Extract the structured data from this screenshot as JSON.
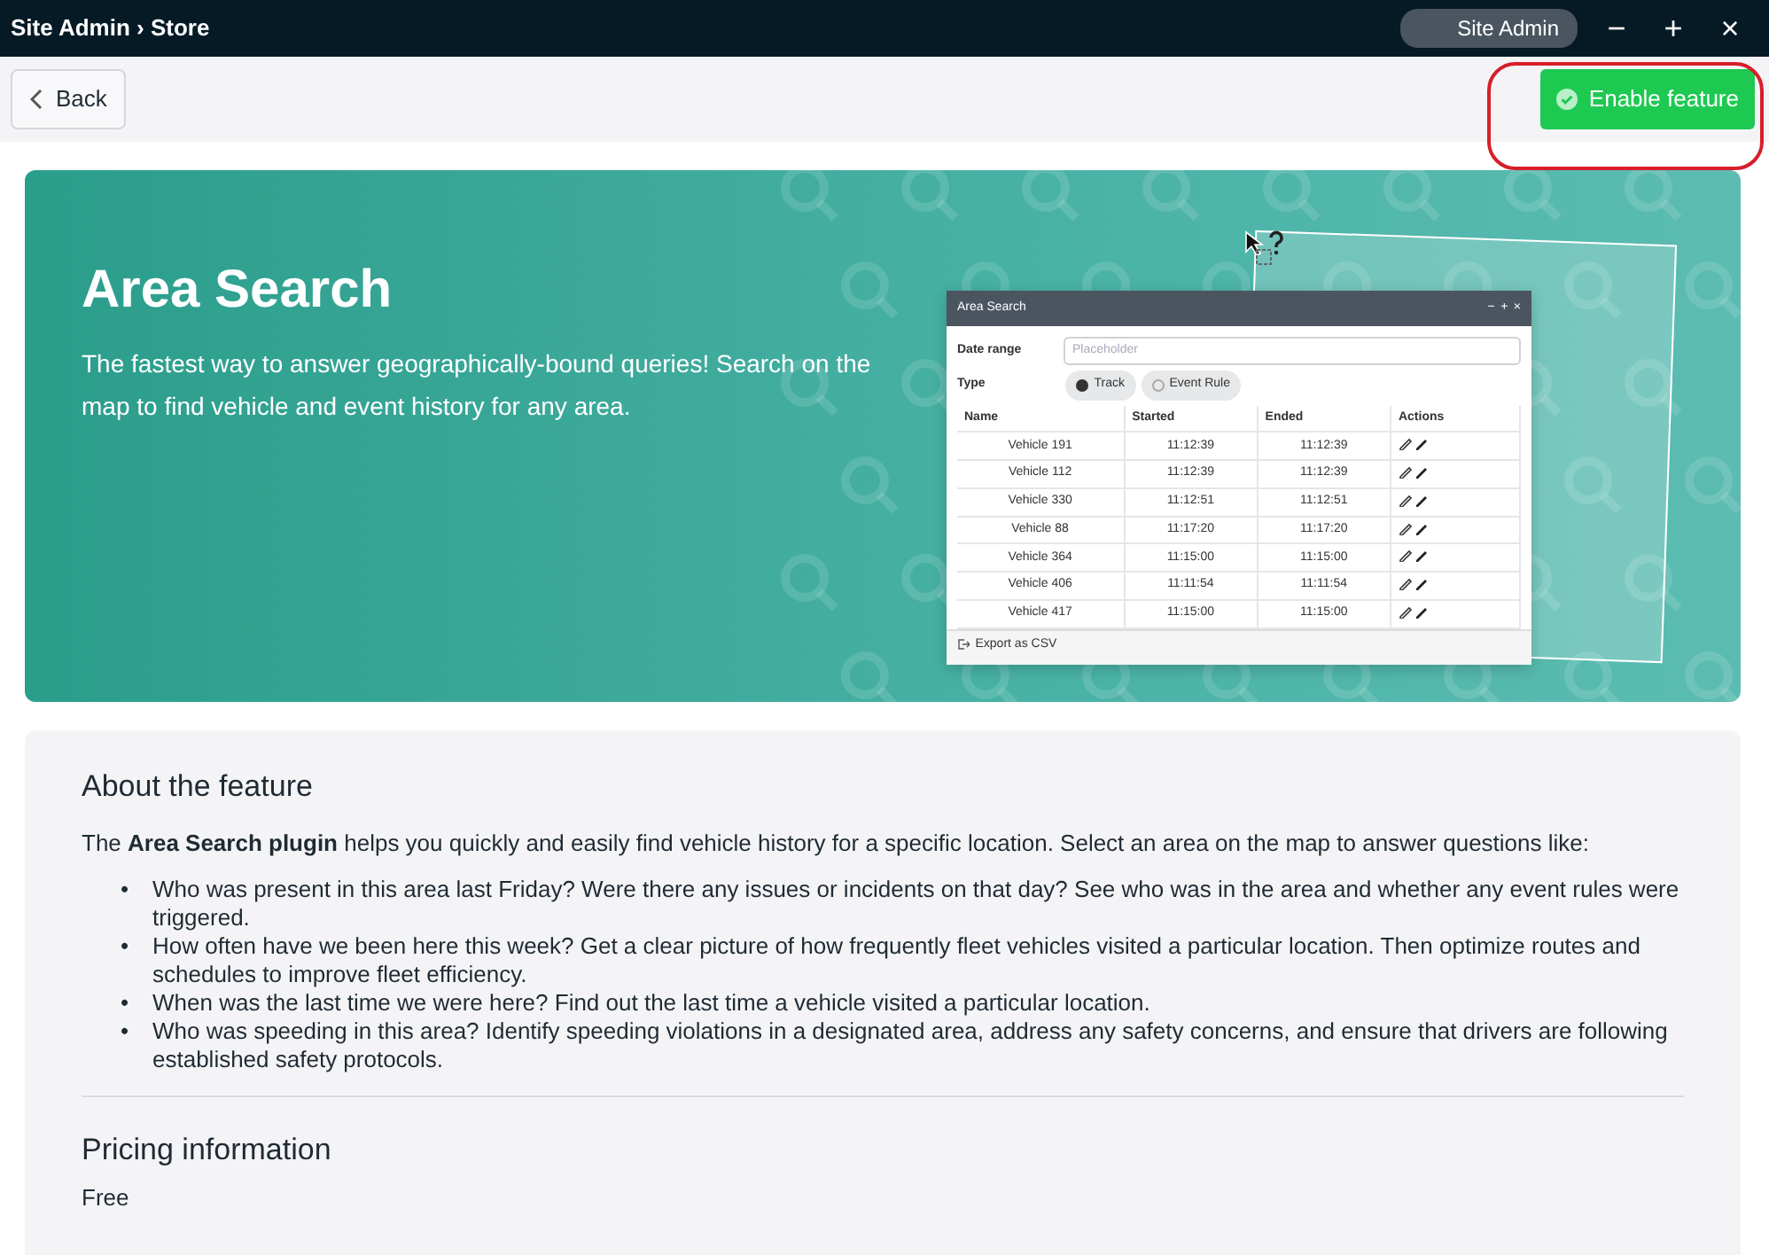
{
  "window": {
    "title": "Site Admin › Store",
    "user": "Site Admin",
    "controls": [
      "−",
      "+",
      "×"
    ]
  },
  "toolbar": {
    "back": "Back",
    "enable": "Enable feature"
  },
  "hero": {
    "title": "Area Search",
    "description": "The fastest way to answer geographically-bound queries! Search on the map to find vehicle and event history for any area.",
    "mockup": {
      "title": "Area Search",
      "controls": [
        "−",
        "+",
        "×"
      ],
      "date_label": "Date range",
      "date_placeholder": "Placeholder",
      "type_label": "Type",
      "options": [
        {
          "label": "Track",
          "selected": true
        },
        {
          "label": "Event Rule",
          "selected": false
        }
      ],
      "columns": [
        "Name",
        "Started",
        "Ended",
        "Actions"
      ],
      "rows": [
        {
          "name": "Vehicle 191",
          "started": "11:12:39",
          "ended": "11:12:39"
        },
        {
          "name": "Vehicle 112",
          "started": "11:12:39",
          "ended": "11:12:39"
        },
        {
          "name": "Vehicle 330",
          "started": "11:12:51",
          "ended": "11:12:51"
        },
        {
          "name": "Vehicle 88",
          "started": "11:17:20",
          "ended": "11:17:20"
        },
        {
          "name": "Vehicle 364",
          "started": "11:15:00",
          "ended": "11:15:00"
        },
        {
          "name": "Vehicle 406",
          "started": "11:11:54",
          "ended": "11:11:54"
        },
        {
          "name": "Vehicle 417",
          "started": "11:15:00",
          "ended": "11:15:00"
        }
      ],
      "export": "Export as CSV"
    }
  },
  "about": {
    "heading": "About the feature",
    "intro": "The **Area Search plugin** helps you quickly and easily find vehicle history for a specific location. Select an area on the map to answer questions like:",
    "marker": "•",
    "bullets": [
      "Who was present in this area last Friday? Were there any issues or incidents on that day? See who was in the area and whether any event rules were triggered.",
      "How often have we been here this week? Get a clear picture of how frequently fleet vehicles visited a particular location. Then optimize routes and schedules to improve fleet efficiency.",
      "When was the last time we were here? Find out the last time a vehicle visited a particular location.",
      "Who was speeding in this area? Identify speeding violations in a designated area, address any safety concerns, and ensure that drivers are following established safety protocols."
    ]
  },
  "pricing": {
    "heading": "Pricing information",
    "value": "Free"
  }
}
